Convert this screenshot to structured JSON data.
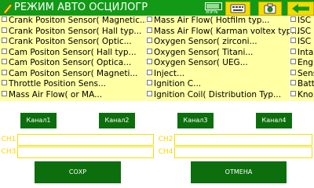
{
  "app": {
    "title": "РЕЖИМ АВТО ОСЦИЛОГР",
    "battery_percent": "89%"
  },
  "colors": {
    "title_bar": "#129a16",
    "panel": "#ffffa4",
    "button": "#0d6e0d",
    "toolbar_button": "#f2dc00"
  },
  "toolbar": {
    "icons": [
      "keyboard-icon",
      "camera-icon",
      "back-arrow-icon"
    ]
  },
  "sensors": {
    "col1": [
      "Crank Positon Sensor( Magnetic...",
      "Crank Positon Sensor( Hall typ...",
      "Crank Positon Sensor( Optic...",
      "Cam Positon Sensor( Hall typ...",
      "Cam Positon Sensor( Optica...",
      "Cam Positon Sensor( Magneti...",
      "Throttle Position Sens...",
      "Mass Air Flow( or MA..."
    ],
    "col2": [
      "Mass Air Flow( Hotfilm typ...",
      "Mass Air Flow( Karman voltex typ...",
      "Oxygen Sensor( zirconi...",
      "Oxygen Sensor( Titani...",
      "Oxygen Sensor( UEG...",
      "Inject...",
      "Ignition C...",
      "Ignition Coil( Distribution Typ..."
    ],
    "col3": [
      "ISC",
      "ISC",
      "ISC",
      "Inta",
      "Eng",
      "Sens",
      "Batt",
      "Kno"
    ]
  },
  "channels": {
    "buttons": [
      "Канал1",
      "Канал2",
      "Канал3",
      "Канал4"
    ],
    "labels": [
      "CH1",
      "CH2",
      "CH3",
      "CH4"
    ],
    "values": [
      "",
      "",
      "",
      ""
    ]
  },
  "actions": {
    "save": "СОХР",
    "cancel": "ОТМЕНА"
  }
}
